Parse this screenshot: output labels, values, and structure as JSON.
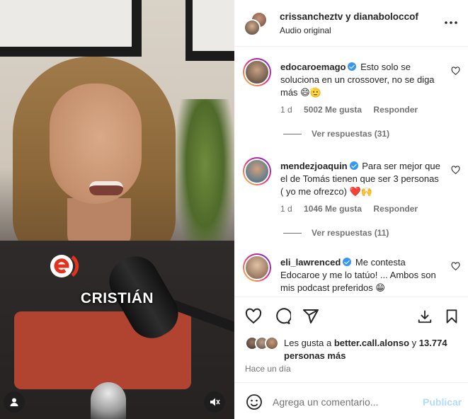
{
  "video": {
    "caption": "CRISTIÁN",
    "brand_color": "#e3311d",
    "logo_icon": "channel-logo-e-icon",
    "user_icon": "user-tag-icon",
    "mute_icon": "muted-speaker-icon"
  },
  "header": {
    "names": "crissancheztv y dianaboloccof",
    "subtitle": "Audio original",
    "more_icon": "more-options-icon"
  },
  "comments": [
    {
      "user": "edocaroemago",
      "text": "Esto solo se soluciona en un crossover, no se diga más 😄🫡",
      "age": "1 d",
      "likes": "5002 Me gusta",
      "reply": "Responder",
      "replies": "Ver respuestas (31)"
    },
    {
      "user": "mendezjoaquin",
      "text": "Para ser mejor que el de Tomás tienen que ser 3 personas ( yo me ofrezco) ❤️🙌",
      "age": "1 d",
      "likes": "1046 Me gusta",
      "reply": "Responder",
      "replies": "Ver respuestas (11)"
    },
    {
      "user": "eli_lawrenced",
      "text": "Me contesta Edocaroe y me lo tatúo! ... Ambos son mis podcast preferidos 😁"
    }
  ],
  "likes": {
    "prefix": "Les gusta a",
    "user": "better.call.alonso",
    "joiner": "y",
    "count": "13.774 personas más"
  },
  "time": "Hace un día",
  "composer": {
    "placeholder": "Agrega un comentario...",
    "post_label": "Publicar"
  },
  "colors": {
    "verified": "#3897f0",
    "secondary_text": "#737373",
    "post_disabled": "#b3dbff"
  }
}
